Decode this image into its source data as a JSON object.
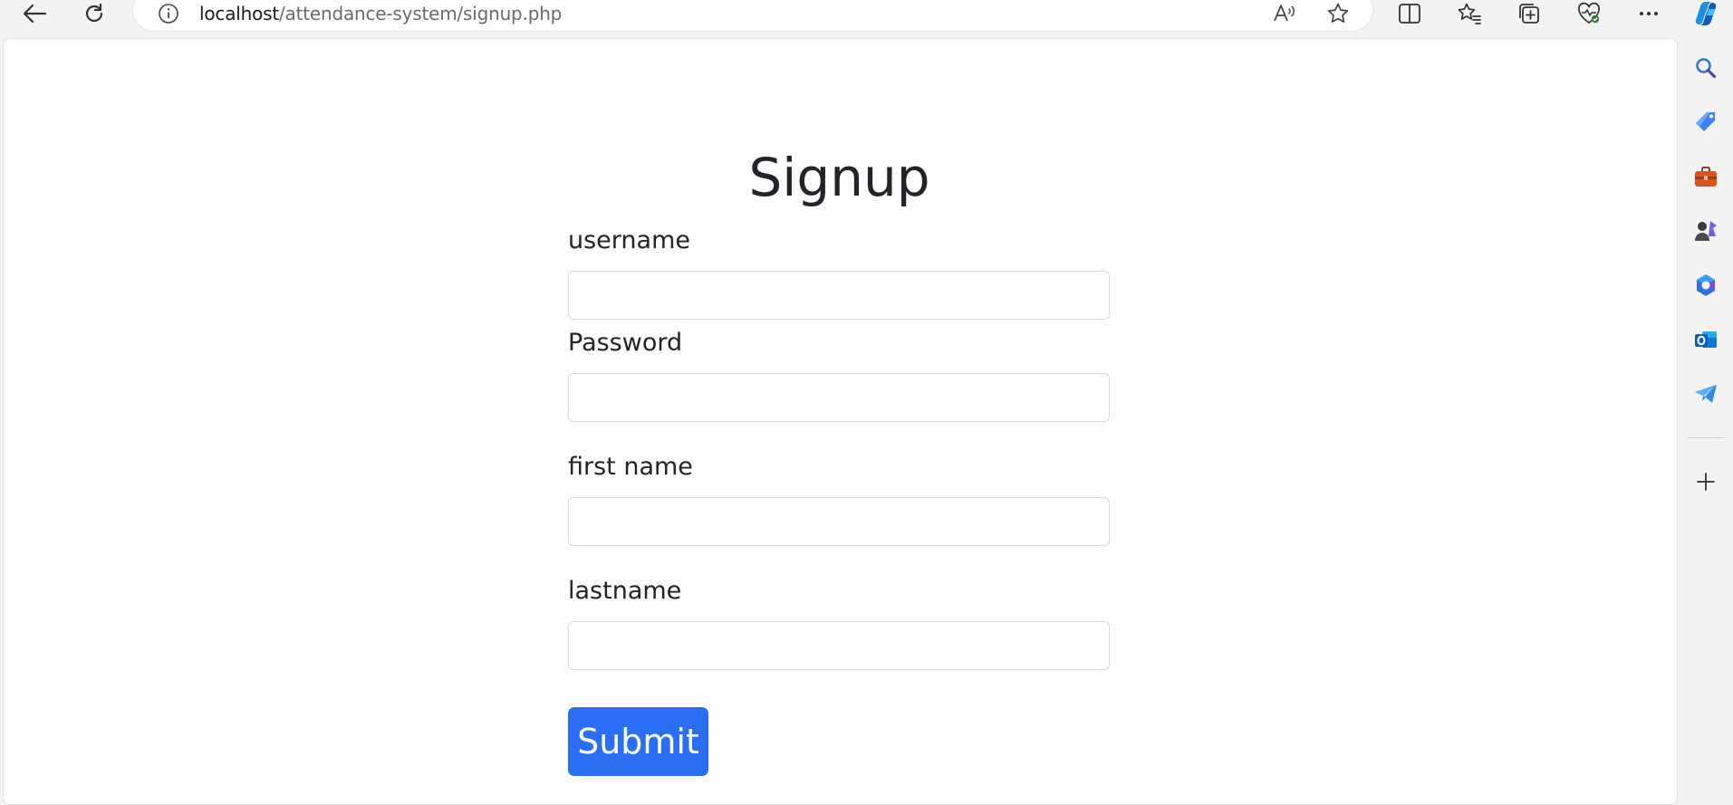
{
  "browser": {
    "url_host": "localhost",
    "url_path": "/attendance-system/signup.php",
    "toolbar_icons": [
      "back-icon",
      "refresh-icon",
      "info-icon",
      "read-aloud-icon",
      "favorite-star-icon",
      "split-screen-icon",
      "favorites-icon",
      "collections-icon",
      "browser-essentials-icon",
      "more-icon",
      "copilot-icon"
    ],
    "sidebar_icons": [
      "search-icon",
      "shopping-tag-icon",
      "tools-icon",
      "games-icon",
      "microsoft-365-icon",
      "outlook-icon",
      "telegram-icon",
      "add-icon"
    ]
  },
  "form": {
    "title": "Signup",
    "fields": [
      {
        "label": "username",
        "value": "",
        "placeholder": ""
      },
      {
        "label": "Password",
        "value": "",
        "placeholder": ""
      },
      {
        "label": "first name",
        "value": "",
        "placeholder": ""
      },
      {
        "label": "lastname",
        "value": "",
        "placeholder": ""
      }
    ],
    "submit_label": "Submit"
  },
  "colors": {
    "accent": "#2a6ff3",
    "text": "#212529",
    "page_bg": "#fdfdfd"
  }
}
